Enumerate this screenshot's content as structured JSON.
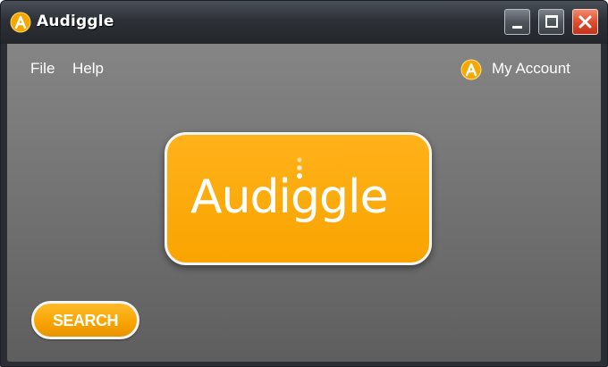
{
  "window": {
    "title": "Audiggle"
  },
  "menu": {
    "file": "File",
    "help": "Help"
  },
  "account": {
    "label": "My Account"
  },
  "logo": {
    "text": "Audiggle"
  },
  "actions": {
    "search_label": "SEARCH"
  },
  "colors": {
    "brand_orange": "#f9a400",
    "titlebar_dark": "#2d3137",
    "close_red": "#dc4a2a"
  },
  "icons": {
    "title_logo": "audiggle-logo-icon",
    "minimize": "minimize-icon",
    "maximize": "maximize-icon",
    "close": "close-icon",
    "account": "account-icon"
  }
}
